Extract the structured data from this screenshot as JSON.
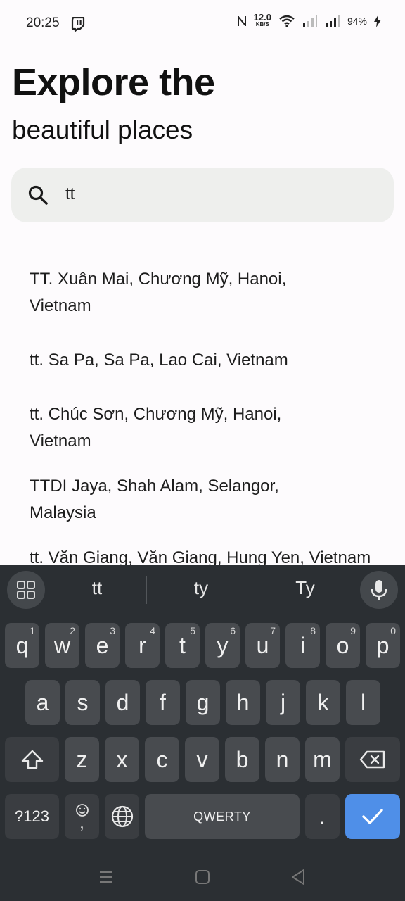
{
  "status": {
    "time": "20:25",
    "speed_num": "12.0",
    "speed_unit": "KB/S",
    "battery": "94%"
  },
  "header": {
    "title_line1": "Explore the",
    "title_line2": "beautiful places"
  },
  "search": {
    "query": "tt"
  },
  "results": [
    "TT. Xuân Mai, Chương Mỹ, Hanoi, Vietnam",
    "tt. Sa Pa, Sa Pa, Lao Cai, Vietnam",
    "tt. Chúc Sơn, Chương Mỹ, Hanoi, Vietnam",
    "TTDI Jaya, Shah Alam, Selangor, Malaysia",
    "tt. Văn Giang, Văn Giang, Hung Yen, Vietnam"
  ],
  "keyboard": {
    "suggestions": [
      "tt",
      "ty",
      "Ty"
    ],
    "row1": [
      {
        "label": "q",
        "hint": "1"
      },
      {
        "label": "w",
        "hint": "2"
      },
      {
        "label": "e",
        "hint": "3"
      },
      {
        "label": "r",
        "hint": "4"
      },
      {
        "label": "t",
        "hint": "5"
      },
      {
        "label": "y",
        "hint": "6"
      },
      {
        "label": "u",
        "hint": "7"
      },
      {
        "label": "i",
        "hint": "8"
      },
      {
        "label": "o",
        "hint": "9"
      },
      {
        "label": "p",
        "hint": "0"
      }
    ],
    "row2": [
      "a",
      "s",
      "d",
      "f",
      "g",
      "h",
      "j",
      "k",
      "l"
    ],
    "row3": [
      "z",
      "x",
      "c",
      "v",
      "b",
      "n",
      "m"
    ],
    "symbols_label": "?123",
    "emoji_comma": ",",
    "space_label": "QWERTY",
    "period": "."
  },
  "colors": {
    "enter_key": "#4f8fe8",
    "keyboard_bg": "#2b2f33",
    "search_bg": "#eeefed"
  }
}
